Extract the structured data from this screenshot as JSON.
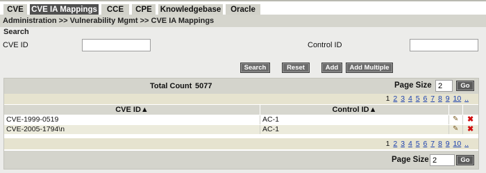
{
  "tabs": [
    {
      "label": "CVE",
      "active": false
    },
    {
      "label": "CVE IA Mappings",
      "active": true
    },
    {
      "label": "CCE",
      "active": false
    },
    {
      "label": "CPE",
      "active": false
    },
    {
      "label": "Knowledgebase",
      "active": false
    },
    {
      "label": "Oracle",
      "active": false
    }
  ],
  "breadcrumb": "Administration >> Vulnerability Mgmt >> CVE IA Mappings",
  "search": {
    "title": "Search",
    "cve_id_label": "CVE ID",
    "cve_id_value": "",
    "control_id_label": "Control ID",
    "control_id_value": "",
    "buttons": {
      "search": "Search",
      "reset": "Reset",
      "add": "Add",
      "add_multiple": "Add Multiple"
    }
  },
  "results": {
    "total_count_label": "Total Count",
    "total_count": "5077",
    "page_size_label": "Page Size",
    "page_size_top": "2",
    "page_size_bottom": "2",
    "go_label": "Go",
    "pages": [
      "1",
      "2",
      "3",
      "4",
      "5",
      "6",
      "7",
      "8",
      "9",
      "10",
      ".."
    ],
    "current_page": "1",
    "columns": {
      "cve_id": "CVE ID▲",
      "control_id": "Control ID▲"
    },
    "rows": [
      {
        "cve_id": "CVE-1999-0519",
        "control_id": "AC-1"
      },
      {
        "cve_id": "CVE-2005-1794\\n",
        "control_id": "AC-1"
      }
    ]
  },
  "icons": {
    "edit": "pencil-icon",
    "delete": "delete-x-icon"
  },
  "colors": {
    "active_tab": "#505050",
    "tab": "#d2d2ca",
    "link": "#1a3fae",
    "delete": "#d01010",
    "panel": "#ececea"
  }
}
